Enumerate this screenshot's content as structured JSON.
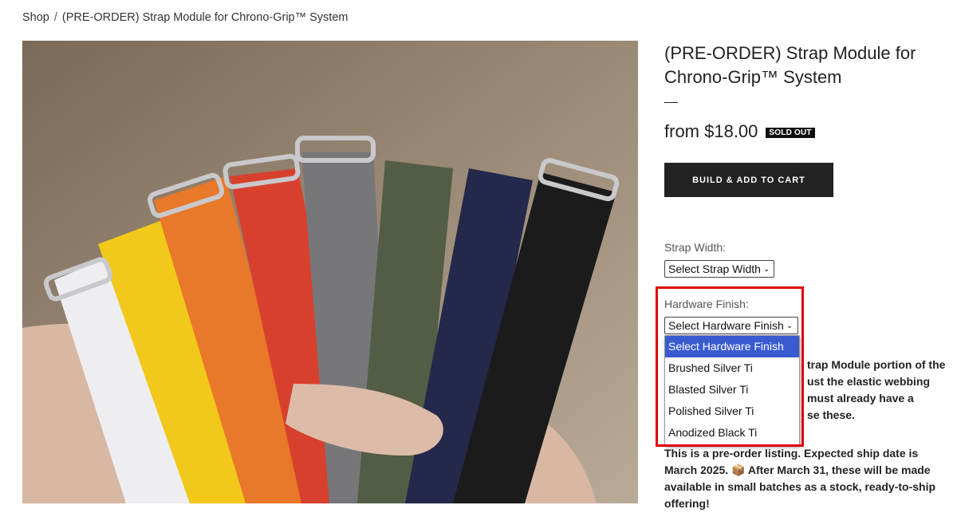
{
  "breadcrumb": {
    "home": "Shop",
    "separator": "/",
    "current": "(PRE-ORDER) Strap Module for Chrono-Grip™ System"
  },
  "product": {
    "title": "(PRE-ORDER) Strap Module for Chrono-Grip™ System",
    "price": "from $18.00",
    "badge": "SOLD OUT",
    "cta_label": "BUILD & ADD TO CART"
  },
  "options": {
    "strap_width": {
      "label": "Strap Width:",
      "value": "Select Strap Width"
    },
    "hardware_finish": {
      "label": "Hardware Finish:",
      "value": "Select Hardware Finish",
      "dropdown_open": true,
      "options": [
        "Select Hardware Finish",
        "Brushed Silver Ti",
        "Blasted Silver Ti",
        "Polished Silver Ti",
        "Anodized Black Ti"
      ]
    }
  },
  "description": {
    "partial_lines": [
      "trap Module portion of the",
      "ust the elastic webbing",
      "must already have a",
      "se these."
    ],
    "preorder_note": "This is a pre-order listing. Expected ship date is March 2025. 📦 After March 31, these will be made available in small batches as a stock, ready-to-ship offering!"
  },
  "colors": {
    "accent_button": "#222222",
    "highlight_box": "#e00000",
    "dropdown_selected": "#3a5bd0"
  }
}
